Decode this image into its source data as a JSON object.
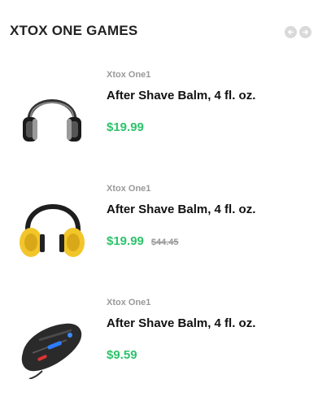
{
  "section": {
    "title": "XTOX ONE GAMES",
    "nav": {
      "prev_icon": "arrow-left-icon",
      "next_icon": "arrow-right-icon"
    }
  },
  "colors": {
    "price": "#2cc36b",
    "muted": "#999999",
    "nav": "#d9d9d9"
  },
  "products": [
    {
      "brand": "Xtox One1",
      "name": "After Shave Balm, 4 fl. oz.",
      "price": "$19.99",
      "old_price": "",
      "image": "headphones-icon"
    },
    {
      "brand": "Xtox One1",
      "name": "After Shave Balm, 4 fl. oz.",
      "price": "$19.99",
      "old_price": "$44.45",
      "image": "yellow-earmuffs-icon"
    },
    {
      "brand": "Xtox One1",
      "name": "After Shave Balm, 4 fl. oz.",
      "price": "$9.59",
      "old_price": "",
      "image": "gaming-mouse-icon"
    }
  ]
}
